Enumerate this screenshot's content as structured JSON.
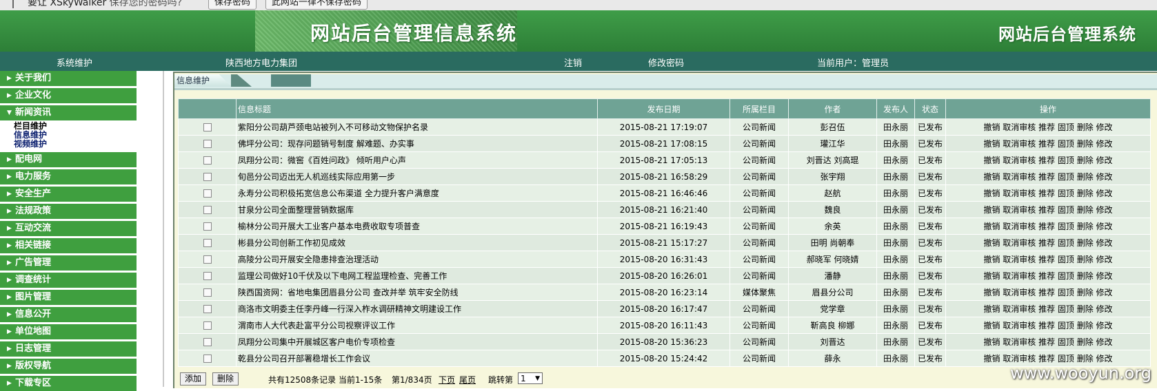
{
  "browser_bar": {
    "text_main": "要让 XSkyWalker",
    "text_sub": "保存您的密码吗?",
    "save_button": "保存密码",
    "never_button": "此网站一律不保存密码"
  },
  "header": {
    "title_main": "网站后台管理信息系统",
    "title_right": "网站后台管理系统"
  },
  "nav": {
    "system": "系统维护",
    "org": "陕西地方电力集团",
    "logout": "注销",
    "change_password": "修改密码",
    "current_user": "当前用户：管理员"
  },
  "sidebar": {
    "items_top": [
      "关于我们",
      "企业文化"
    ],
    "open_item": "新闻资讯",
    "sub_items": [
      "栏目维护",
      "信息维护",
      "视频维护"
    ],
    "items_bottom": [
      "配电网",
      "电力服务",
      "安全生产",
      "法规政策",
      "互动交流",
      "相关链接",
      "广告管理",
      "调查统计",
      "图片管理",
      "信息公开",
      "单位地图",
      "日志管理",
      "版权导航",
      "下载专区"
    ]
  },
  "tabs": {
    "active": "信息维护"
  },
  "table": {
    "headers": [
      "",
      "信息标题",
      "发布日期",
      "所属栏目",
      "作者",
      "发布人",
      "状态",
      "操作"
    ],
    "ops_text": "撤销 取消审核 推荐 固顶 删除 修改",
    "rows": [
      {
        "title": "紫阳分公司葫芦颈电站被列入不可移动文物保护名录",
        "date": "2015-08-21 17:19:07",
        "column": "公司新闻",
        "author": "彭召伍",
        "publisher": "田永丽",
        "status": "已发布"
      },
      {
        "title": "佛坪分公司：现存问题销号制度 解难题、办实事",
        "date": "2015-08-21 17:08:15",
        "column": "公司新闻",
        "author": "瓘江华",
        "publisher": "田永丽",
        "status": "已发布"
      },
      {
        "title": "凤翔分公司：微窖《百姓问政》 倾听用户心声",
        "date": "2015-08-21 17:05:13",
        "column": "公司新闻",
        "author": "刘晋达 刘高琨",
        "publisher": "田永丽",
        "status": "已发布"
      },
      {
        "title": "旬邑分公司迈出无人机巡线实际应用第一步",
        "date": "2015-08-21 16:58:29",
        "column": "公司新闻",
        "author": "张宇翔",
        "publisher": "田永丽",
        "status": "已发布"
      },
      {
        "title": "永寿分公司积极拓宽信息公布渠道 全力提升客户满意度",
        "date": "2015-08-21 16:46:46",
        "column": "公司新闻",
        "author": "赵航",
        "publisher": "田永丽",
        "status": "已发布"
      },
      {
        "title": "甘泉分公司全面整理营销数据库",
        "date": "2015-08-21 16:21:40",
        "column": "公司新闻",
        "author": "魏良",
        "publisher": "田永丽",
        "status": "已发布"
      },
      {
        "title": "榆林分公司开展大工业客户基本电费收取专项普查",
        "date": "2015-08-21 16:19:43",
        "column": "公司新闻",
        "author": "余英",
        "publisher": "田永丽",
        "status": "已发布"
      },
      {
        "title": "彬县分公司创新工作初见成效",
        "date": "2015-08-21 15:17:27",
        "column": "公司新闻",
        "author": "田明 尚朝奉",
        "publisher": "田永丽",
        "status": "已发布"
      },
      {
        "title": "高陵分公司开展安全隐患排查治理活动",
        "date": "2015-08-20 16:31:43",
        "column": "公司新闻",
        "author": "郝晓军 何晓婧",
        "publisher": "田永丽",
        "status": "已发布"
      },
      {
        "title": "监理公司做好10千伏及以下电网工程监理检查、完善工作",
        "date": "2015-08-20 16:26:01",
        "column": "公司新闻",
        "author": "潘静",
        "publisher": "田永丽",
        "status": "已发布"
      },
      {
        "title": "陕西国资网：省地电集团眉县分公司 查改并举 筑牢安全防线",
        "date": "2015-08-20 16:23:14",
        "column": "媒体聚焦",
        "author": "眉县分公司",
        "publisher": "田永丽",
        "status": "已发布"
      },
      {
        "title": "商洛市文明委主任李丹峰一行深入柞水调研精神文明建设工作",
        "date": "2015-08-20 16:17:47",
        "column": "公司新闻",
        "author": "党学章",
        "publisher": "田永丽",
        "status": "已发布"
      },
      {
        "title": "渭南市人大代表赴富平分公司视察评议工作",
        "date": "2015-08-20 16:11:43",
        "column": "公司新闻",
        "author": "靳高良 柳娜",
        "publisher": "田永丽",
        "status": "已发布"
      },
      {
        "title": "凤翔分公司集中开展城区客户电价专项检查",
        "date": "2015-08-20 15:36:23",
        "column": "公司新闻",
        "author": "刘晋达",
        "publisher": "田永丽",
        "status": "已发布"
      },
      {
        "title": "乾县分公司召开部署稳增长工作会议",
        "date": "2015-08-20 15:24:42",
        "column": "公司新闻",
        "author": "薛永",
        "publisher": "田永丽",
        "status": "已发布"
      }
    ]
  },
  "footer": {
    "add_button": "添加",
    "delete_button": "删除",
    "total": "共有12508条记录",
    "current": "当前1-15条",
    "page": "第1/834页",
    "next": "下页",
    "last": "尾页",
    "jump_label": "跳转第",
    "jump_value": "1"
  },
  "watermark": "www.wooyun.org"
}
